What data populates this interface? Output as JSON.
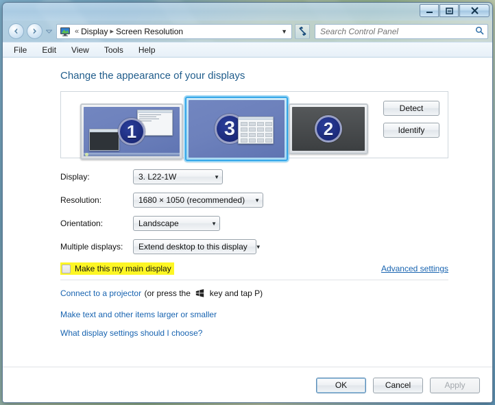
{
  "window": {
    "controls": {
      "minimize": "minimize-icon",
      "maximize": "maximize-icon",
      "close": "close-icon"
    }
  },
  "nav": {
    "back": "back-arrow-icon",
    "forward": "forward-arrow-icon",
    "history_caret": "chevron-down-icon",
    "addr_icon": "display-monitor-icon",
    "crumb_prefix": "«",
    "crumbs": [
      "Display",
      "Screen Resolution"
    ],
    "crumb_separator": "▸",
    "addr_dropdown": "▼",
    "refresh_icon": "refresh-icon",
    "search_placeholder": "Search Control Panel",
    "search_value": "",
    "search_icon": "search-icon"
  },
  "menubar": {
    "items": [
      "File",
      "Edit",
      "View",
      "Tools",
      "Help"
    ]
  },
  "main": {
    "heading": "Change the appearance of your displays",
    "monitors": [
      {
        "number": "1",
        "state": "active",
        "selected": false
      },
      {
        "number": "3",
        "state": "active",
        "selected": true
      },
      {
        "number": "2",
        "state": "off",
        "selected": false
      }
    ],
    "detect_label": "Detect",
    "identify_label": "Identify",
    "fields": [
      {
        "label": "Display:",
        "value": "3. L22-1W"
      },
      {
        "label": "Resolution:",
        "value": "1680 × 1050 (recommended)"
      },
      {
        "label": "Orientation:",
        "value": "Landscape"
      },
      {
        "label": "Multiple displays:",
        "value": "Extend desktop to this display"
      }
    ],
    "main_display_checkbox": {
      "label": "Make this my main display",
      "checked": false,
      "disabled": true,
      "highlighted": true,
      "highlight_color": "#fdf624"
    },
    "advanced_settings": "Advanced settings",
    "links": {
      "projector_link": "Connect to a projector",
      "projector_tail_pre": "(or press the",
      "projector_tail_post": "key and tap P)",
      "windows_key_icon": "windows-logo-icon",
      "text_size": "Make text and other items larger or smaller",
      "help": "What display settings should I choose?"
    }
  },
  "footer": {
    "ok": "OK",
    "cancel": "Cancel",
    "apply": "Apply",
    "apply_disabled": true
  },
  "colors": {
    "heading": "#1f5c8b",
    "link": "#1763b0",
    "selection": "#33a6e8",
    "highlight": "#fdf624"
  }
}
